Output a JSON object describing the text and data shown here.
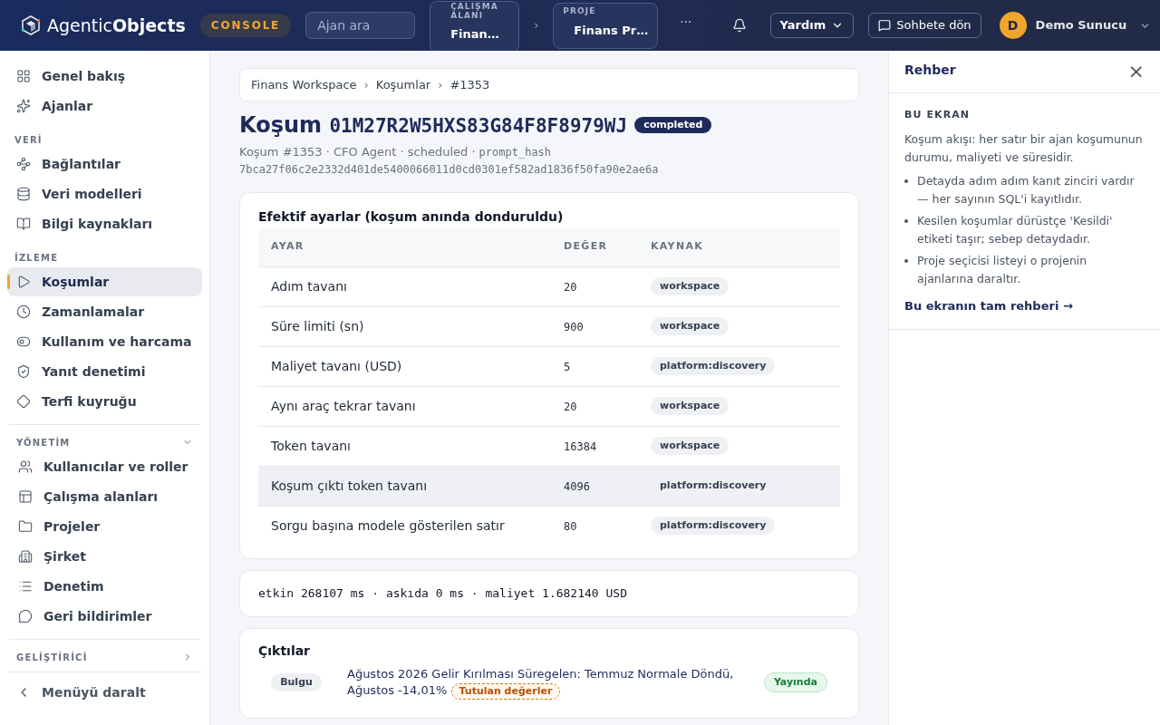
{
  "header": {
    "brand_regular": "Agentic",
    "brand_bold": "Objects",
    "badge": "CONSOLE",
    "search": {
      "placeholder": "Ajan ara"
    },
    "workspace": {
      "label": "ÇALIŞMA ALANI",
      "value": "Finan…"
    },
    "separator": "›",
    "project": {
      "label": "PROJE",
      "value": "Finans Pr…"
    },
    "more": "···",
    "help": "Yardım",
    "chat": "Sohbete dön",
    "user": {
      "initial": "D",
      "name": "Demo Sunucu"
    }
  },
  "sidebar": {
    "sections": [
      {
        "items": [
          {
            "label": "Genel bakış",
            "selected": false
          },
          {
            "label": "Ajanlar",
            "selected": false
          }
        ]
      },
      {
        "title": "VERİ",
        "items": [
          {
            "label": "Bağlantılar",
            "selected": false
          },
          {
            "label": "Veri modelleri",
            "selected": false
          },
          {
            "label": "Bilgi kaynakları",
            "selected": false
          }
        ]
      },
      {
        "title": "İZLEME",
        "items": [
          {
            "label": "Koşumlar",
            "selected": true
          },
          {
            "label": "Zamanlamalar",
            "selected": false
          },
          {
            "label": "Kullanım ve harcama",
            "selected": false
          },
          {
            "label": "Yanıt denetimi",
            "selected": false
          },
          {
            "label": "Terfi kuyruğu",
            "selected": false
          }
        ]
      },
      {
        "title": "YÖNETİM",
        "expanded": true,
        "items": [
          {
            "label": "Kullanıcılar ve roller",
            "selected": false
          },
          {
            "label": "Çalışma alanları",
            "selected": false
          },
          {
            "label": "Projeler",
            "selected": false
          },
          {
            "label": "Şirket",
            "selected": false
          },
          {
            "label": "Denetim",
            "selected": false
          },
          {
            "label": "Geri bildirimler",
            "selected": false
          }
        ]
      },
      {
        "title": "GELİŞTİRİCİ",
        "expanded": false
      }
    ],
    "collapse": "Menüyü daralt"
  },
  "breadcrumb": [
    "Finans Workspace",
    "Koşumlar",
    "#1353"
  ],
  "breadcrumb_separator": "›",
  "run": {
    "title": "Koşum",
    "id": "01M27R2W5HXS83G84F8F8979WJ",
    "status": "completed",
    "meta": "Koşum #1353 · CFO Agent · scheduled ·",
    "hash_label": "prompt_hash",
    "hash": "7bca27f06c2e2332d401de5400066011d0cd0301ef582ad1836f50fa90e2ae6a"
  },
  "settings": {
    "title": "Efektif ayarlar (koşum anında donduruldu)",
    "columns": [
      "AYAR",
      "DEĞER",
      "KAYNAK"
    ],
    "rows": [
      {
        "name": "Adım tavanı",
        "value": "20",
        "source": "workspace",
        "highlighted": false
      },
      {
        "name": "Süre limiti (sn)",
        "value": "900",
        "source": "workspace",
        "highlighted": false
      },
      {
        "name": "Maliyet tavanı (USD)",
        "value": "5",
        "source": "platform:discovery",
        "highlighted": false
      },
      {
        "name": "Aynı araç tekrar tavanı",
        "value": "20",
        "source": "workspace",
        "highlighted": false
      },
      {
        "name": "Token tavanı",
        "value": "16384",
        "source": "workspace",
        "highlighted": false
      },
      {
        "name": "Koşum çıktı token tavanı",
        "value": "4096",
        "source": "platform:discovery",
        "highlighted": true
      },
      {
        "name": "Sorgu başına modele gösterilen satır",
        "value": "80",
        "source": "platform:discovery",
        "highlighted": false
      }
    ]
  },
  "timing": "etkin 268107 ms · askıda 0 ms · maliyet 1.682140 USD",
  "outputs": {
    "title": "Çıktılar",
    "items": [
      {
        "type": "Bulgu",
        "title": "Ağustos 2026 Gelir Kırılması Süregelen: Temmuz Normale Döndü, Ağustos -14,01%",
        "tag": "Tutulan değerler",
        "status": "Yayında"
      }
    ]
  },
  "guide": {
    "title": "Rehber",
    "close": "×",
    "section": "BU EKRAN",
    "intro": "Koşum akışı: her satır bir ajan koşumunun durumu, maliyeti ve süresidir.",
    "bullets": [
      "Detayda adım adım kanıt zinciri vardır — her sayının SQL'i kayıtlıdır.",
      "Kesilen koşumlar dürüstçe 'Kesildi' etiketi taşır; sebep detaydadır.",
      "Proje seçicisi listeyi o projenin ajanlarına daraltır."
    ],
    "link": "Bu ekranın tam rehberi →"
  }
}
